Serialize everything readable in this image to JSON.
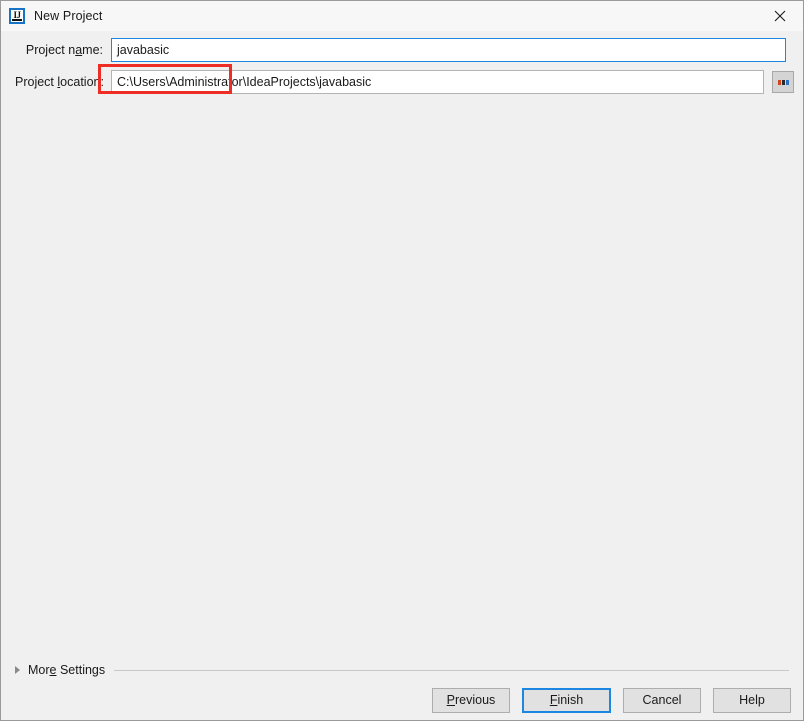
{
  "window": {
    "title": "New Project",
    "icon": "intellij-idea-icon",
    "close_icon": "close-icon",
    "background_color": "#f0f0f0",
    "titlebar_color": "#f7f7f7"
  },
  "form": {
    "project_name": {
      "label_before": "Project n",
      "label_mnemonic": "a",
      "label_after": "me:",
      "label_full": "Project name:",
      "value": "javabasic",
      "placeholder": "",
      "focused": true,
      "border_color": "#1b87e0"
    },
    "project_location": {
      "label_before": "Project ",
      "label_mnemonic": "l",
      "label_after": "ocation:",
      "label_full": "Project location:",
      "value": "C:\\Users\\Administrator\\IdeaProjects\\javabasic",
      "placeholder": "",
      "focused": false,
      "border_color": "#b4b4b4"
    },
    "browse_button": {
      "label": "...",
      "icon": "browse-ellipsis-icon"
    }
  },
  "annotation": {
    "color": "#ee2d24",
    "target": "project-name-input"
  },
  "more_settings": {
    "before": "Mor",
    "mnemonic": "e",
    "after": " Settings",
    "full": "More Settings",
    "expanded": false,
    "expander_icon": "chevron-right-icon"
  },
  "footer": {
    "buttons": [
      {
        "name": "previous",
        "before": "",
        "mnemonic": "P",
        "after": "revious",
        "full": "Previous",
        "default": false
      },
      {
        "name": "finish",
        "before": "",
        "mnemonic": "F",
        "after": "inish",
        "full": "Finish",
        "default": true
      },
      {
        "name": "cancel",
        "before": "Cancel",
        "mnemonic": "",
        "after": "",
        "full": "Cancel",
        "default": false
      },
      {
        "name": "help",
        "before": "Help",
        "mnemonic": "",
        "after": "",
        "full": "Help",
        "default": false
      }
    ],
    "default_border_color": "#1b87e0"
  }
}
